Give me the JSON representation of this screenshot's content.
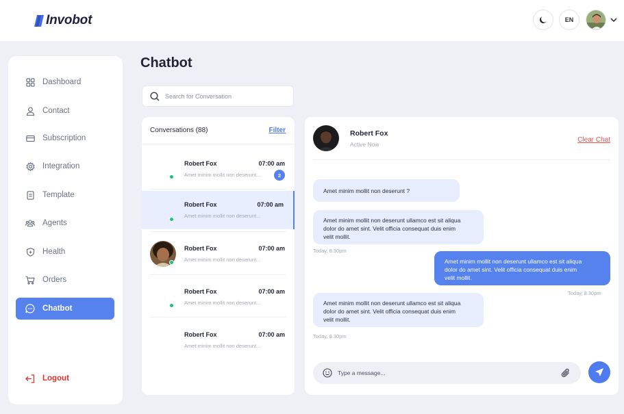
{
  "brand": {
    "name": "Invobot"
  },
  "header": {
    "language": "EN"
  },
  "sidebar": {
    "items": [
      {
        "label": "Dashboard",
        "icon": "grid-icon"
      },
      {
        "label": "Contact",
        "icon": "user-icon"
      },
      {
        "label": "Subscription",
        "icon": "card-icon"
      },
      {
        "label": "Integration",
        "icon": "gear-icon"
      },
      {
        "label": "Template",
        "icon": "document-icon"
      },
      {
        "label": "Agents",
        "icon": "users-icon"
      },
      {
        "label": "Health",
        "icon": "shield-icon"
      },
      {
        "label": "Orders",
        "icon": "cart-icon"
      },
      {
        "label": "Chatbot",
        "icon": "chat-icon",
        "active": true
      }
    ],
    "logout": "Logout"
  },
  "page": {
    "title": "Chatbot"
  },
  "search": {
    "placeholder": "Search for Conversation"
  },
  "conversations": {
    "header": "Conversations (88)",
    "filter": "Filter",
    "items": [
      {
        "name": "Robert Fox",
        "time": "07:00 am",
        "preview": "Amet minim mollit non deserunt...",
        "online": true,
        "unread": "2"
      },
      {
        "name": "Robert Fox",
        "time": "07:00 am",
        "preview": "Amet minim mollit non deserunt...",
        "online": true,
        "selected": true
      },
      {
        "name": "Robert Fox",
        "time": "07:00 am",
        "preview": "Amet minim mollit non deserunt...",
        "online": true,
        "avatar": true
      },
      {
        "name": "Robert Fox",
        "time": "07:00 am",
        "preview": "Amet minim mollit non deserunt...",
        "online": true
      },
      {
        "name": "Robert Fox",
        "time": "07:00 am",
        "preview": "Amet minim mollit non deserunt...",
        "online": false
      }
    ]
  },
  "chat": {
    "contact_name": "Robert Fox",
    "contact_status": "Active Now",
    "clear": "Clear Chat",
    "messages": [
      {
        "from": "in",
        "text": "Amet minim mollit non deserunt ?"
      },
      {
        "from": "in",
        "line1": "Amet minim mollit non deserunt ullamco est sit aliqua",
        "line2": "dolor do amet sint. Velit officia consequat duis enim",
        "line3": "velit mollit.",
        "time": "Today, 8.30pm"
      },
      {
        "from": "out",
        "line1": "Amet minim mollit non deserunt ullamco est sit aliqua",
        "line2": "dolor do amet sint. Velit officia consequat duis enim",
        "line3": "velit mollit.",
        "time": "Today, 8.30pm"
      },
      {
        "from": "in",
        "line1": "Amet minim mollit non deserunt ullamco est sit aliqua",
        "line2": "dolor do amet sint. Velit officia consequat duis enim",
        "line3": "velit mollit.",
        "time": "Today, 8.30pm"
      }
    ],
    "composer_placeholder": "Type a message..."
  },
  "colors": {
    "accent": "#5682ee",
    "online": "#19c37d",
    "danger": "#e0342f"
  }
}
